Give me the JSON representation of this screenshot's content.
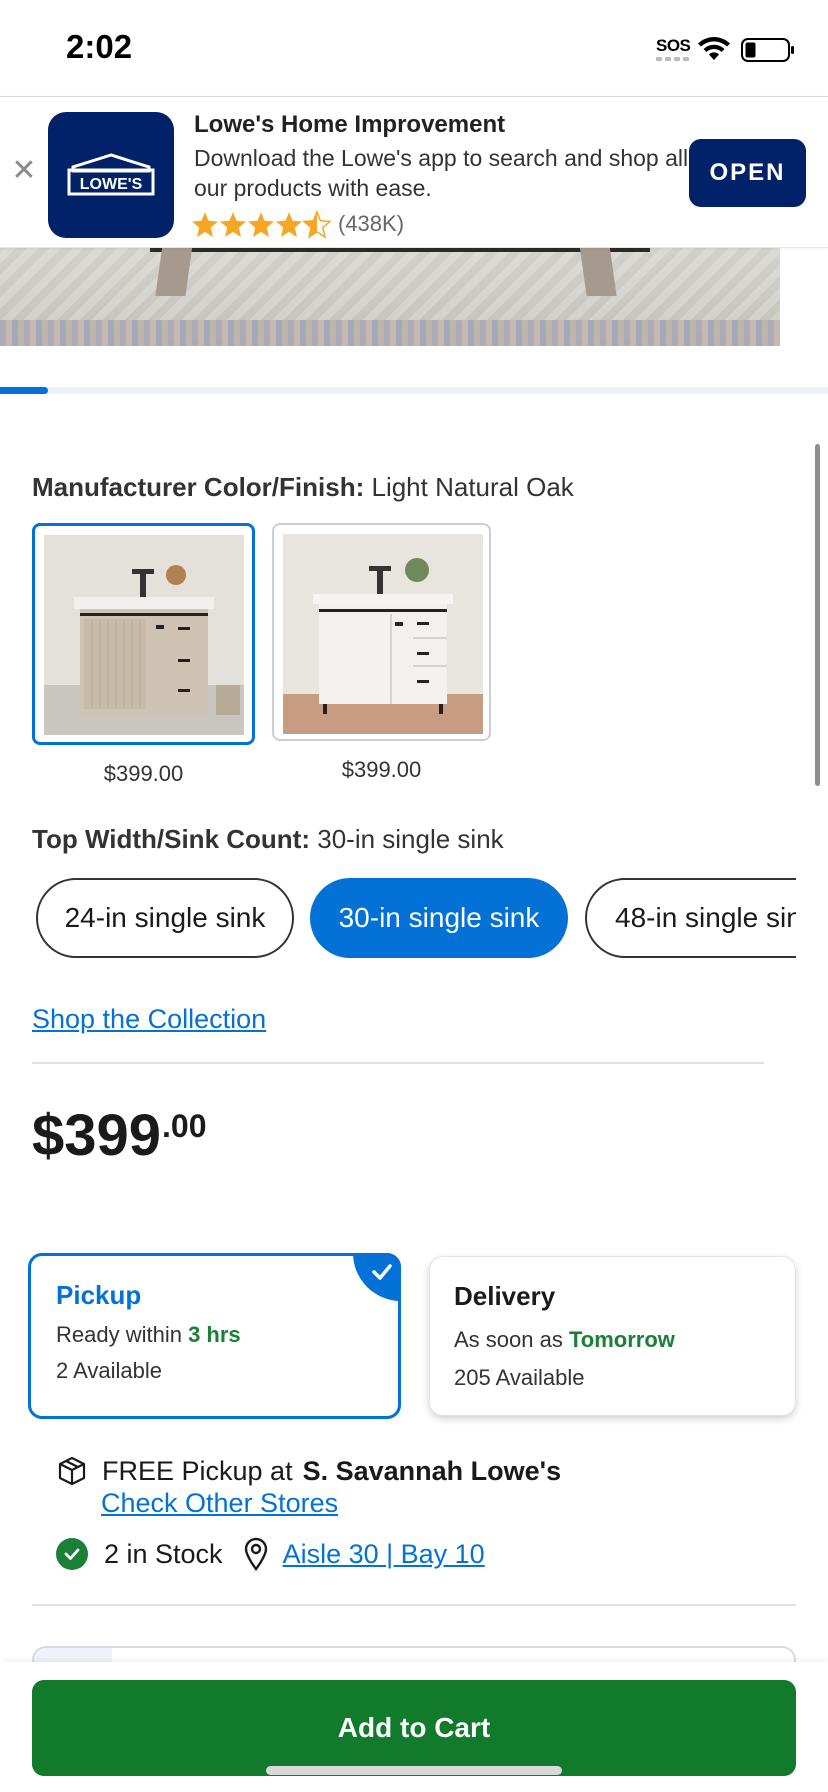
{
  "status_bar": {
    "time": "2:02",
    "sos": "SOS"
  },
  "app_banner": {
    "title": "Lowe's Home Improvement",
    "description": "Download the Lowe's app to search and shop all our products with ease.",
    "rating": 4.5,
    "rating_count": "(438K)",
    "open_label": "OPEN",
    "logo_text": "LOWE'S",
    "colors": {
      "brand": "#012169",
      "star": "#f5a623"
    }
  },
  "carousel": {
    "current_index": 1,
    "progress": 0.06
  },
  "color_finish": {
    "label": "Manufacturer Color/Finish:",
    "value": "Light Natural Oak",
    "swatches": [
      {
        "name": "Light Natural Oak",
        "price": "$399.00",
        "selected": true
      },
      {
        "name": "White",
        "price": "$399.00",
        "selected": false
      }
    ]
  },
  "size": {
    "label": "Top Width/Sink Count:",
    "value": "30-in single sink",
    "options": [
      {
        "label": "24-in single sink",
        "selected": false
      },
      {
        "label": "30-in single sink",
        "selected": true
      },
      {
        "label": "48-in single sin",
        "selected": false
      }
    ]
  },
  "shop_collection_label": "Shop the Collection",
  "price": {
    "dollars": "$399",
    "cents": ".00"
  },
  "fulfillment": {
    "pickup": {
      "title": "Pickup",
      "ready_prefix": "Ready within",
      "ready_value": "3 hrs",
      "available": "2 Available",
      "selected": true
    },
    "delivery": {
      "title": "Delivery",
      "eta_prefix": "As soon as",
      "eta_value": "Tomorrow",
      "available": "205 Available",
      "selected": false
    }
  },
  "store": {
    "pickup_prefix": "FREE Pickup at",
    "store_name": "S. Savannah Lowe's",
    "check_other_stores": "Check Other Stores",
    "stock_text": "2 in Stock",
    "aisle_text": "Aisle 30 | Bay 10"
  },
  "cart": {
    "add_label": "Add to Cart"
  },
  "colors": {
    "accent_blue": "#0471d6",
    "stock_green": "#1a7f37",
    "cart_green": "#117a2b"
  }
}
